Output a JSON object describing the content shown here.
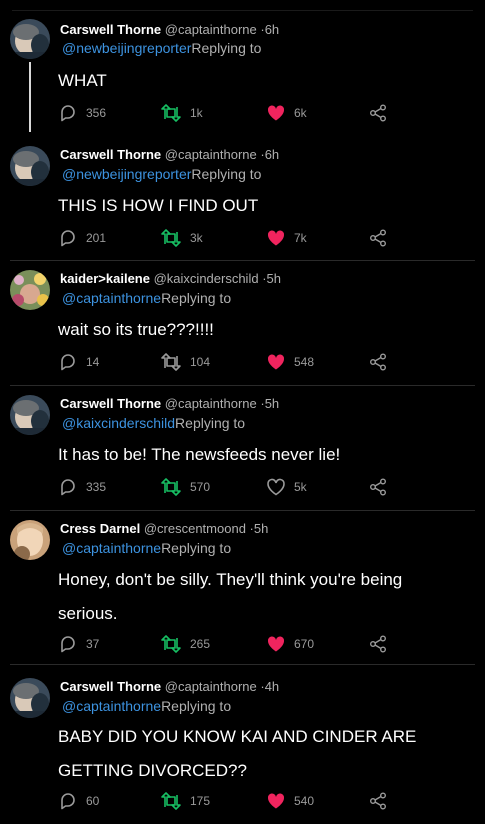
{
  "tweets": [
    {
      "name": "Carswell Thorne",
      "handle": "@captainthorne",
      "time": "·6h",
      "reply_to": "@newbeijingreporter",
      "reply_suffix": "Replying to",
      "text": [
        "WHAT"
      ],
      "replies": "356",
      "retweets": "1k",
      "likes": "6k",
      "liked": true,
      "avatar": "thorne"
    },
    {
      "name": "Carswell Thorne",
      "handle": "@captainthorne",
      "time": "·6h",
      "reply_to": "@newbeijingreporter",
      "reply_suffix": "Replying to",
      "text": [
        "THIS IS HOW I FIND OUT"
      ],
      "replies": "201",
      "retweets": "3k",
      "likes": "7k",
      "liked": true,
      "avatar": "thorne"
    },
    {
      "name": "kaider>kailene",
      "handle": "@kaixcinderschild",
      "time": "·5h",
      "reply_to": "@captainthorne",
      "reply_suffix": "Replying to",
      "text": [
        "wait so its true???!!!!"
      ],
      "replies": "14",
      "retweets": "104",
      "likes": "548",
      "liked": true,
      "avatar": "kailene"
    },
    {
      "name": "Carswell Thorne",
      "handle": "@captainthorne",
      "time": "·5h",
      "reply_to": "@kaixcinderschild",
      "reply_suffix": "Replying to",
      "text": [
        "It has to be! The newsfeeds never lie!"
      ],
      "replies": "335",
      "retweets": "570",
      "likes": "5k",
      "liked": false,
      "avatar": "thorne"
    },
    {
      "name": "Cress Darnel",
      "handle": "@crescentmoond",
      "time": "·5h",
      "reply_to": "@captainthorne",
      "reply_suffix": "Replying to",
      "text": [
        "Honey, don't be silly. They'll think you're being",
        "serious."
      ],
      "replies": "37",
      "retweets": "265",
      "likes": "670",
      "liked": true,
      "avatar": "cress"
    },
    {
      "name": "Carswell Thorne",
      "handle": "@captainthorne",
      "time": "·4h",
      "reply_to": "@captainthorne",
      "reply_suffix": "Replying to",
      "text": [
        "BABY DID YOU KNOW KAI AND CINDER ARE",
        "GETTING DIVORCED??"
      ],
      "replies": "60",
      "retweets": "175",
      "likes": "540",
      "liked": true,
      "avatar": "thorne"
    }
  ],
  "colors": {
    "like": "#f0245e",
    "retweet": "#17bf63",
    "mention": "#3d93e0",
    "muted": "#9a9a9a"
  },
  "icons": {
    "reply": "reply-icon",
    "retweet": "retweet-icon",
    "like": "heart-icon",
    "share": "share-icon"
  }
}
